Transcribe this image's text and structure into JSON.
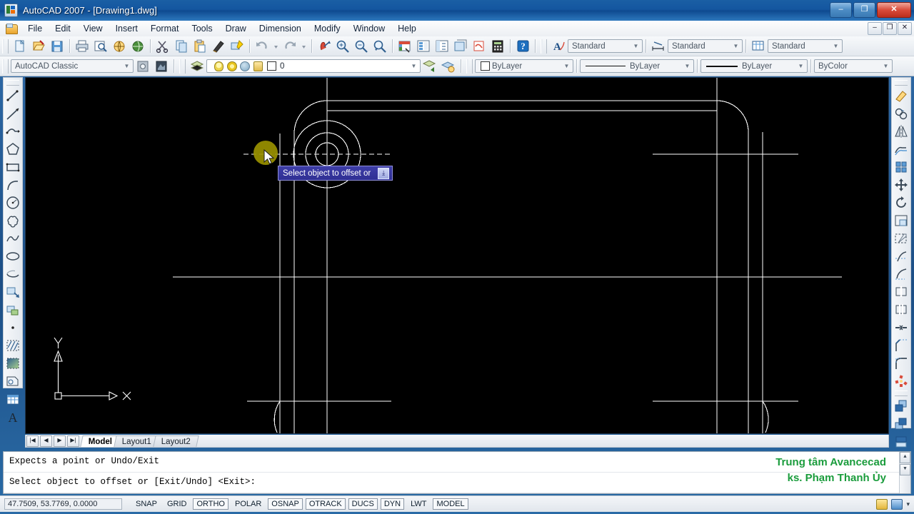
{
  "window": {
    "title": "AutoCAD 2007 - [Drawing1.dwg]",
    "app_icon": "autocad-icon",
    "minimize": "–",
    "maximize": "❐",
    "close": "✕",
    "inner_minimize": "–",
    "inner_restore": "❐",
    "inner_close": "✕"
  },
  "menu": {
    "doc_icon": "document-icon",
    "items": [
      {
        "label": "File"
      },
      {
        "label": "Edit"
      },
      {
        "label": "View"
      },
      {
        "label": "Insert"
      },
      {
        "label": "Format"
      },
      {
        "label": "Tools"
      },
      {
        "label": "Draw"
      },
      {
        "label": "Dimension"
      },
      {
        "label": "Modify"
      },
      {
        "label": "Window"
      },
      {
        "label": "Help"
      }
    ]
  },
  "standard_toolbar": {
    "icons": [
      "new-icon",
      "open-icon",
      "save-icon",
      "plot-icon",
      "plot-preview-icon",
      "publish-icon",
      "3dorbit-icon",
      "cut-icon",
      "copy-icon",
      "paste-icon",
      "match-properties-icon",
      "block-editor-icon",
      "undo-icon",
      "redo-icon",
      "pan-icon",
      "zoom-realtime-icon",
      "zoom-window-icon",
      "zoom-previous-icon",
      "properties-icon",
      "designcenter-icon",
      "tool-palettes-icon",
      "sheet-set-icon",
      "markup-icon",
      "quick-calc-icon",
      "help-icon"
    ]
  },
  "styles_toolbar": {
    "text_style_icon": "text-style-icon",
    "text_style": "Standard",
    "dim_style_icon": "dimension-style-icon",
    "dim_style": "Standard",
    "table_style_icon": "table-style-icon",
    "table_style": "Standard"
  },
  "workspaces_toolbar": {
    "workspace": "AutoCAD Classic",
    "workspace_settings_icon": "workspace-settings-icon",
    "my_workspace_icon": "my-workspace-icon"
  },
  "layers_toolbar": {
    "layer_properties_icon": "layer-properties-icon",
    "on_icon": "lightbulb-icon",
    "freeze_icon": "sun-icon",
    "freeze_vp_icon": "snowflake-icon",
    "lock_icon": "lock-icon",
    "color_swatch_icon": "color-swatch-icon",
    "current_layer": "0",
    "layer_previous_icon": "layer-previous-icon",
    "make_current_icon": "make-object-layer-current-icon"
  },
  "properties_toolbar": {
    "color_icon": "color-swatch-icon",
    "color": "ByLayer",
    "linetype": "ByLayer",
    "lineweight": "ByLayer",
    "plot_style": "ByColor"
  },
  "draw_toolbar": {
    "name": "Draw",
    "icons": [
      "line-icon",
      "construction-line-icon",
      "polyline-icon",
      "polygon-icon",
      "rectangle-icon",
      "arc-icon",
      "circle-icon",
      "revision-cloud-icon",
      "spline-icon",
      "ellipse-icon",
      "ellipse-arc-icon",
      "insert-block-icon",
      "make-block-icon",
      "point-icon",
      "hatch-icon",
      "gradient-icon",
      "region-icon",
      "table-icon",
      "multiline-text-icon"
    ]
  },
  "modify_toolbar": {
    "name": "Modify",
    "icons": [
      "erase-icon",
      "copy-object-icon",
      "mirror-icon",
      "offset-icon",
      "array-icon",
      "move-icon",
      "rotate-icon",
      "scale-icon",
      "stretch-icon",
      "trim-icon",
      "extend-icon",
      "break-at-point-icon",
      "break-icon",
      "join-icon",
      "chamfer-icon",
      "fillet-icon",
      "explode-icon",
      "bring-to-front-icon",
      "send-to-back-icon",
      "bring-above-object-icon",
      "send-under-object-icon"
    ]
  },
  "drawing": {
    "background_color": "#000000",
    "geometry_color": "#ffffff",
    "highlight_color": "#9a9100",
    "ucs_icon": {
      "x_label": "X",
      "y_label": "Y"
    },
    "tooltip": {
      "text": "Select object to offset or",
      "expand_icon": "dynamic-input-expand-icon"
    },
    "cursor_icon": "arrow-cursor-icon"
  },
  "layout_tabs": {
    "first_icon": "first-tab-icon",
    "prev_icon": "previous-tab-icon",
    "next_icon": "next-tab-icon",
    "last_icon": "last-tab-icon",
    "tabs": [
      {
        "label": "Model",
        "active": true
      },
      {
        "label": "Layout1",
        "active": false
      },
      {
        "label": "Layout2",
        "active": false
      }
    ]
  },
  "command_window": {
    "lines": [
      "Expects a point or Undo/Exit",
      "Select object to offset or [Exit/Undo] <Exit>:"
    ],
    "scroll_up_icon": "scroll-up-icon",
    "scroll_down_icon": "scroll-down-icon"
  },
  "watermark": {
    "line1": "Trung tâm Avancecad",
    "line2": "ks. Phạm Thanh Ủy",
    "color": "#1a9c3c"
  },
  "status_bar": {
    "coordinates": "47.7509, 53.7769, 0.0000",
    "toggles": [
      {
        "label": "SNAP",
        "on": false
      },
      {
        "label": "GRID",
        "on": false
      },
      {
        "label": "ORTHO",
        "on": true
      },
      {
        "label": "POLAR",
        "on": false
      },
      {
        "label": "OSNAP",
        "on": true
      },
      {
        "label": "OTRACK",
        "on": true
      },
      {
        "label": "DUCS",
        "on": true
      },
      {
        "label": "DYN",
        "on": true
      },
      {
        "label": "LWT",
        "on": false
      },
      {
        "label": "MODEL",
        "on": true
      }
    ],
    "tray_icons": [
      "communication-center-icon",
      "annotation-scale-icon"
    ],
    "expand_icon": "expand-tray-icon"
  }
}
